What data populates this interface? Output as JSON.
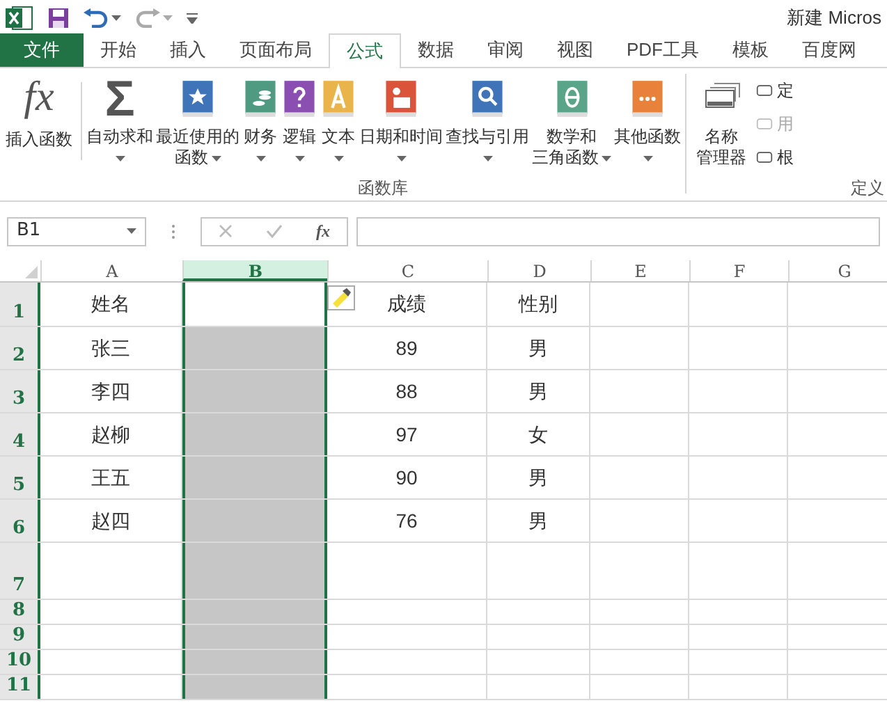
{
  "window": {
    "title": "新建 Micros"
  },
  "tabs": [
    {
      "label": "文件",
      "kind": "file",
      "selected": false
    },
    {
      "label": "开始",
      "kind": "tab",
      "selected": false
    },
    {
      "label": "插入",
      "kind": "tab",
      "selected": false
    },
    {
      "label": "页面布局",
      "kind": "tab",
      "selected": false
    },
    {
      "label": "公式",
      "kind": "tab",
      "selected": true
    },
    {
      "label": "数据",
      "kind": "tab",
      "selected": false
    },
    {
      "label": "审阅",
      "kind": "tab",
      "selected": false
    },
    {
      "label": "视图",
      "kind": "tab",
      "selected": false
    },
    {
      "label": "PDF工具",
      "kind": "tab",
      "selected": false
    },
    {
      "label": "模板",
      "kind": "tab",
      "selected": false
    },
    {
      "label": "百度网",
      "kind": "tab",
      "selected": false
    }
  ],
  "ribbon": {
    "insert_function": {
      "glyph": "fx",
      "label": "插入函数"
    },
    "group_label": "函数库",
    "buttons": [
      {
        "kind": "sigma",
        "glyph": "Σ",
        "lines": [
          "自动求和"
        ],
        "dropdown": true
      },
      {
        "kind": "book",
        "color": "#3f74b8",
        "lines": [
          "最近使用的",
          "函数"
        ],
        "dropdown": true
      },
      {
        "kind": "book",
        "color": "#4f9a80",
        "lines": [
          "财务"
        ],
        "dropdown": true
      },
      {
        "kind": "book",
        "color": "#8a4fb0",
        "lines": [
          "逻辑"
        ],
        "dropdown": true
      },
      {
        "kind": "book",
        "color": "#e9b54a",
        "lines": [
          "文本"
        ],
        "dropdown": true
      },
      {
        "kind": "book",
        "color": "#d9543a",
        "lines": [
          "日期和时间"
        ],
        "dropdown": true
      },
      {
        "kind": "book",
        "color": "#3f74b8",
        "lines": [
          "查找与引用"
        ],
        "dropdown": true
      },
      {
        "kind": "book",
        "color": "#5aa58a",
        "lines": [
          "数学和",
          "三角函数"
        ],
        "dropdown": true
      },
      {
        "kind": "book",
        "color": "#e8823a",
        "lines": [
          "其他函数"
        ],
        "dropdown": true
      }
    ],
    "name_manager": {
      "lines": [
        "名称",
        "管理器"
      ]
    },
    "side_items": [
      {
        "label": "定",
        "disabled": false
      },
      {
        "label": "用",
        "disabled": true
      },
      {
        "label": "根",
        "disabled": false
      }
    ],
    "right_group_label": "定义"
  },
  "formula_bar": {
    "name_box": "B1",
    "fx": "fx"
  },
  "sheet": {
    "columns": [
      {
        "label": "A",
        "selected": false
      },
      {
        "label": "B",
        "selected": true
      },
      {
        "label": "C",
        "selected": false
      },
      {
        "label": "D",
        "selected": false
      },
      {
        "label": "E",
        "selected": false
      },
      {
        "label": "F",
        "selected": false
      },
      {
        "label": "G",
        "selected": false
      }
    ],
    "rows": [
      {
        "number": "1",
        "active": true,
        "cells": {
          "A": "姓名",
          "C": "成绩",
          "D": "性别"
        }
      },
      {
        "number": "2",
        "active": false,
        "cells": {
          "A": "张三",
          "C": "89",
          "D": "男"
        }
      },
      {
        "number": "3",
        "active": false,
        "cells": {
          "A": "李四",
          "C": "88",
          "D": "男"
        }
      },
      {
        "number": "4",
        "active": false,
        "cells": {
          "A": "赵柳",
          "C": "97",
          "D": "女"
        }
      },
      {
        "number": "5",
        "active": false,
        "cells": {
          "A": "王五",
          "C": "90",
          "D": "男"
        }
      },
      {
        "number": "6",
        "active": false,
        "cells": {
          "A": "赵四",
          "C": "76",
          "D": "男"
        }
      },
      {
        "number": "7",
        "active": false
      },
      {
        "number": "8",
        "active": false
      },
      {
        "number": "9",
        "active": false
      },
      {
        "number": "10",
        "active": false
      },
      {
        "number": "11",
        "active": false
      }
    ]
  }
}
